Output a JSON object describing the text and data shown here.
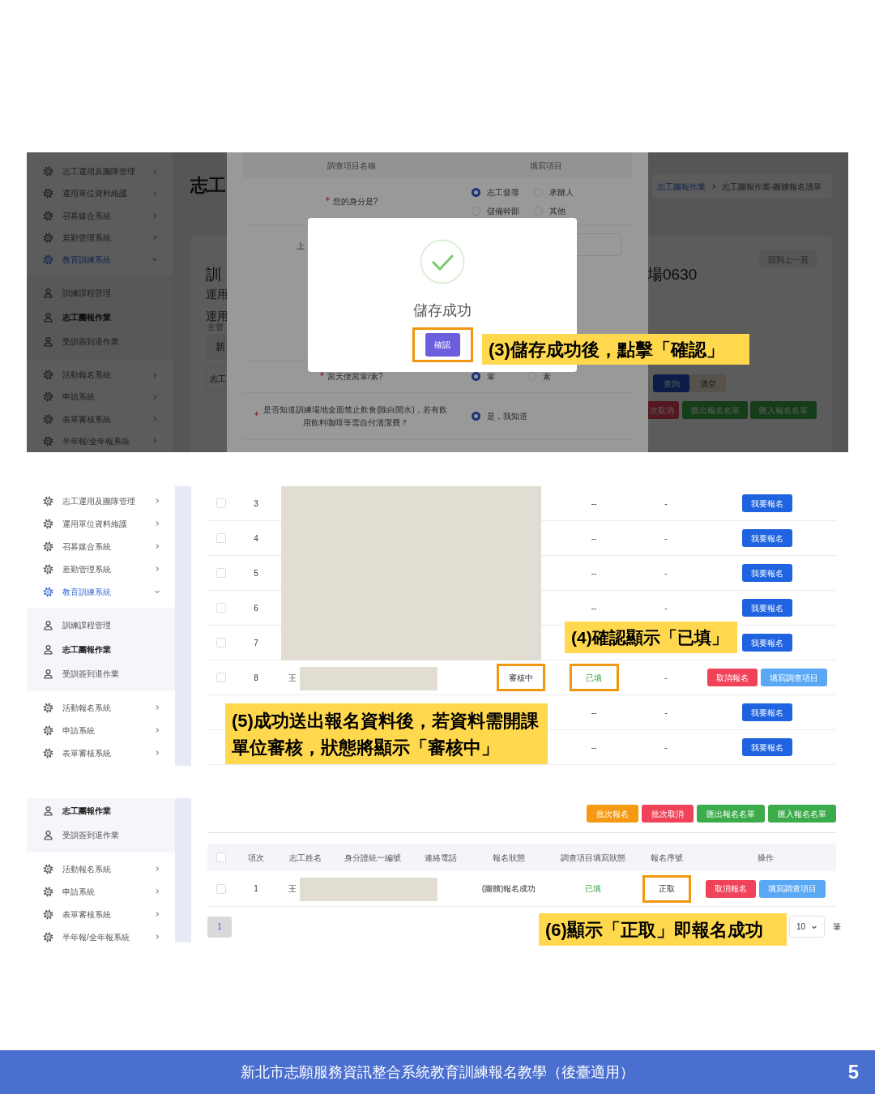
{
  "step3_screenshot": {
    "sidebar": [
      {
        "kind": "menu",
        "label": "志工運用及團隊管理",
        "expanded": false,
        "selected": false
      },
      {
        "kind": "menu",
        "label": "運用單位資料維護",
        "expanded": false,
        "selected": false
      },
      {
        "kind": "menu",
        "label": "召募媒合系統",
        "expanded": false,
        "selected": false
      },
      {
        "kind": "menu",
        "label": "差勤管理系統",
        "expanded": false,
        "selected": false
      },
      {
        "kind": "menu",
        "label": "教育訓練系統",
        "expanded": true,
        "selected": true,
        "children": [
          {
            "label": "訓練課程管理",
            "selected": false
          },
          {
            "label": "志工團報作業",
            "selected": true
          },
          {
            "label": "受訓簽到退作業",
            "selected": false
          }
        ]
      },
      {
        "kind": "menu",
        "label": "活動報名系統",
        "expanded": false,
        "selected": false
      },
      {
        "kind": "menu",
        "label": "申請系統",
        "expanded": false,
        "selected": false
      },
      {
        "kind": "menu",
        "label": "表單審核系統",
        "expanded": false,
        "selected": false
      },
      {
        "kind": "menu",
        "label": "半年報/全年報系統",
        "expanded": false,
        "selected": false
      }
    ],
    "page": {
      "heading": "志工",
      "breadcrumb": [
        {
          "label": "志工團報作業",
          "link": true
        },
        {
          "label": "志工團報作業-團體報名清單",
          "link": false
        }
      ],
      "back_button": "回到上一頁",
      "title_start": "訓",
      "title_end": "場0630",
      "info_lines": [
        "運用",
        "運用"
      ],
      "small_label": "主管",
      "field_value": "新",
      "tab_label": "志工",
      "search_button": "查詢",
      "clear_button": "清空",
      "action_buttons": [
        {
          "kind": "danger",
          "label": "次取消"
        },
        {
          "kind": "success",
          "label": "匯出報名名單"
        },
        {
          "kind": "success",
          "label": "匯入報名名單"
        }
      ]
    },
    "survey": {
      "columns": [
        "調查項目名稱",
        "填寫項目"
      ],
      "rows": [
        {
          "kind": "radio",
          "required": true,
          "question": "您的身分是?",
          "options": [
            {
              "label": "志工督導",
              "selected": true
            },
            {
              "label": "承辦人",
              "selected": false
            },
            {
              "label": "儲備幹部",
              "selected": false
            },
            {
              "label": "其他",
              "selected": false
            }
          ]
        },
        {
          "kind": "text",
          "required": false,
          "question": "上"
        },
        {
          "kind": "radio",
          "required": true,
          "question": "當天便當葷/素?",
          "options": [
            {
              "label": "葷",
              "selected": true
            },
            {
              "label": "素",
              "selected": false
            }
          ]
        },
        {
          "kind": "radio",
          "required": true,
          "question": "是否知道訓練場地全面禁止飲食(除白開水)，若有飲用飲料咖啡等需自付清潔費？",
          "options": [
            {
              "label": "是，我知道",
              "selected": true
            }
          ]
        }
      ]
    },
    "dialog": {
      "message": "儲存成功",
      "confirm_button": "確認",
      "confirm_highlighted": true
    }
  },
  "step5_screenshot": {
    "sidebar": [
      {
        "kind": "menu",
        "label": "志工運用及團隊管理",
        "expanded": false,
        "selected": false
      },
      {
        "kind": "menu",
        "label": "運用單位資料維護",
        "expanded": false,
        "selected": false
      },
      {
        "kind": "menu",
        "label": "召募媒合系統",
        "expanded": false,
        "selected": false
      },
      {
        "kind": "menu",
        "label": "差勤管理系統",
        "expanded": false,
        "selected": false
      },
      {
        "kind": "menu",
        "label": "教育訓練系統",
        "expanded": true,
        "selected": true,
        "children": [
          {
            "label": "訓練課程管理",
            "selected": false
          },
          {
            "label": "志工團報作業",
            "selected": true
          },
          {
            "label": "受訓簽到退作業",
            "selected": false
          }
        ]
      },
      {
        "kind": "menu",
        "label": "活動報名系統",
        "expanded": false,
        "selected": false
      },
      {
        "kind": "menu",
        "label": "申請系統",
        "expanded": false,
        "selected": false
      },
      {
        "kind": "menu",
        "label": "表單審核系統",
        "expanded": false,
        "selected": false
      }
    ],
    "rows": [
      {
        "number": "3",
        "checked": false,
        "redacted": true,
        "survey_status": "--",
        "survey_filled": false,
        "sequence": "-",
        "actions": [
          {
            "kind": "primary",
            "label": "我要報名"
          }
        ]
      },
      {
        "number": "4",
        "checked": false,
        "redacted": true,
        "survey_status": "--",
        "survey_filled": false,
        "sequence": "-",
        "actions": [
          {
            "kind": "primary",
            "label": "我要報名"
          }
        ]
      },
      {
        "number": "5",
        "checked": false,
        "redacted": true,
        "survey_status": "--",
        "survey_filled": false,
        "sequence": "-",
        "actions": [
          {
            "kind": "primary",
            "label": "我要報名"
          }
        ]
      },
      {
        "number": "6",
        "checked": false,
        "redacted": true,
        "survey_status": "--",
        "survey_filled": false,
        "sequence": "-",
        "actions": [
          {
            "kind": "primary",
            "label": "我要報名"
          }
        ]
      },
      {
        "number": "7",
        "checked": false,
        "redacted": true,
        "actions": [
          {
            "kind": "primary",
            "label": "我要報名"
          }
        ]
      },
      {
        "number": "8",
        "checked": false,
        "name": "王",
        "redacted": true,
        "status": "審核中",
        "status_highlighted": true,
        "survey_status": "已填",
        "survey_filled": true,
        "survey_highlighted": true,
        "sequence": "-",
        "actions": [
          {
            "kind": "danger",
            "label": "取消報名"
          },
          {
            "kind": "info",
            "label": "填寫調查項目"
          }
        ]
      },
      {
        "survey_status": "--",
        "survey_filled": false,
        "sequence": "-",
        "actions": [
          {
            "kind": "primary",
            "label": "我要報名"
          }
        ]
      },
      {
        "survey_status": "--",
        "survey_filled": false,
        "sequence": "-",
        "actions": [
          {
            "kind": "primary",
            "label": "我要報名"
          }
        ]
      }
    ]
  },
  "step6_screenshot": {
    "sidebar": [
      {
        "kind": "submenu_group",
        "children": [
          {
            "label": "志工團報作業",
            "selected": true
          },
          {
            "label": "受訓簽到退作業",
            "selected": false
          }
        ]
      },
      {
        "kind": "menu",
        "label": "活動報名系統",
        "expanded": false,
        "selected": false
      },
      {
        "kind": "menu",
        "label": "申請系統",
        "expanded": false,
        "selected": false
      },
      {
        "kind": "menu",
        "label": "表單審核系統",
        "expanded": false,
        "selected": false
      },
      {
        "kind": "menu",
        "label": "半年報/全年報系統",
        "expanded": false,
        "selected": false
      }
    ],
    "toolbar": [
      {
        "kind": "warning",
        "label": "批次報名"
      },
      {
        "kind": "danger",
        "label": "批次取消"
      },
      {
        "kind": "success",
        "label": "匯出報名名單"
      },
      {
        "kind": "success",
        "label": "匯入報名名單"
      }
    ],
    "header_checkbox": {
      "checked": false
    },
    "columns": [
      "項次",
      "志工姓名",
      "身分證統一編號",
      "連絡電話",
      "報名狀態",
      "調查項目填寫狀態",
      "報名序號",
      "操作"
    ],
    "rows": [
      {
        "number": "1",
        "checked": false,
        "name": "王",
        "redacted": true,
        "status": "(團體)報名成功",
        "status_highlighted": false,
        "survey_status": "已填",
        "survey_filled": true,
        "survey_highlighted": false,
        "sequence": "正取",
        "sequence_highlighted": true,
        "actions": [
          {
            "kind": "danger",
            "label": "取消報名"
          },
          {
            "kind": "info",
            "label": "填寫調查項目"
          }
        ]
      }
    ],
    "pagination": {
      "pages": [
        {
          "label": "1",
          "selected": true
        }
      ],
      "page_size": "10",
      "unit": "筆"
    }
  },
  "callouts": [
    "(3)儲存成功後，點擊「確認」",
    "(4)確認顯示「已填」",
    "(5)成功送出報名資料後，若資料需開課單位審核，狀態將顯示「審核中」",
    "(6)顯示「正取」即報名成功"
  ],
  "footer": {
    "title": "新北市志願服務資訊整合系統教育訓練報名教學（後臺適用）",
    "page_number": "5"
  }
}
